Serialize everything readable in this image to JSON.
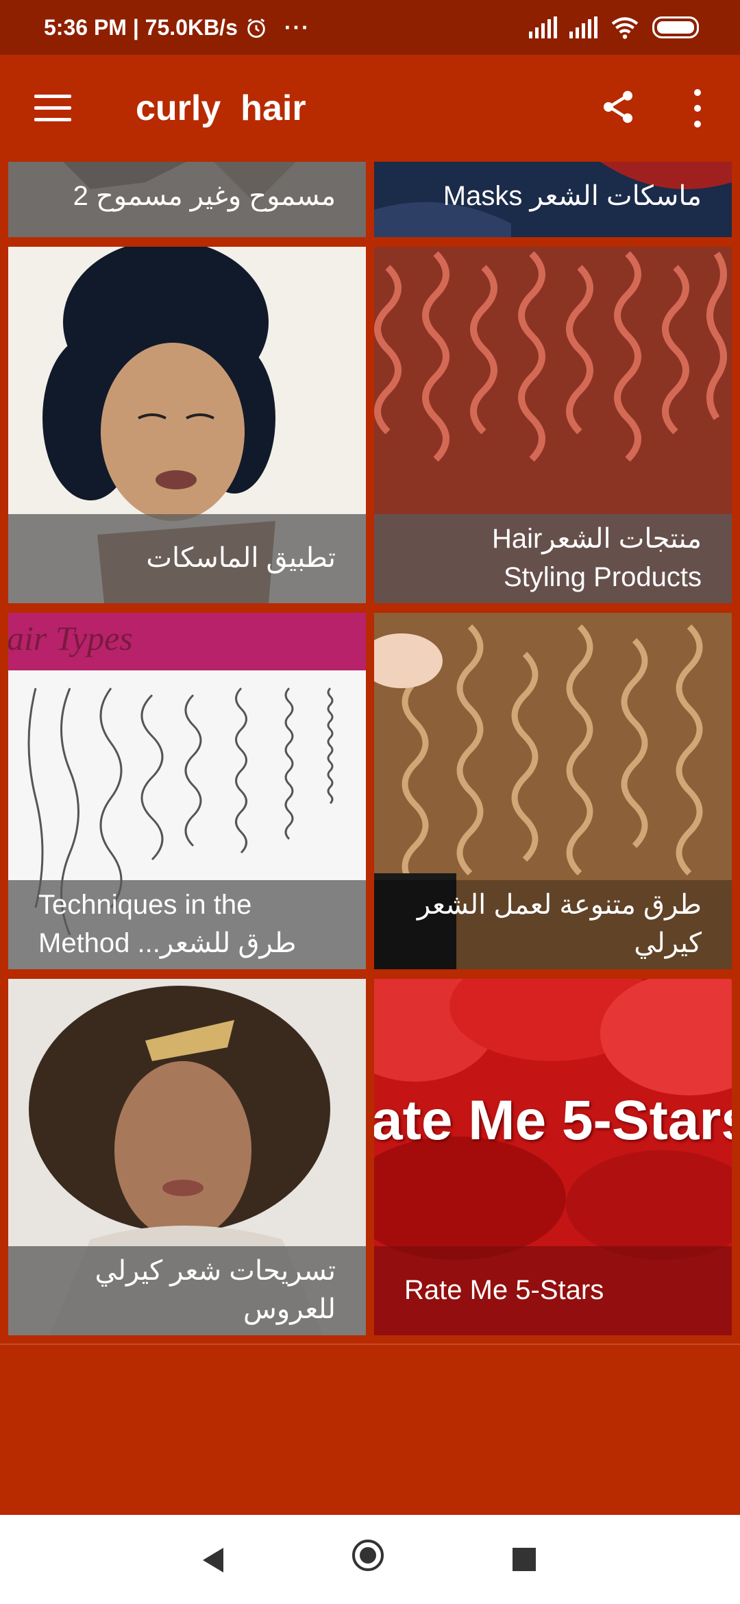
{
  "status_bar": {
    "time_speed": "5:36 PM | 75.0KB/s",
    "alarm_icon": "alarm-clock-icon",
    "more_indicator": "···"
  },
  "app_bar": {
    "title": "curly  hair"
  },
  "cards": [
    {
      "caption": "مسموح وغير مسموح 2",
      "dir": "rtl",
      "colors": [
        "#c8b8a8",
        "#7a6658"
      ]
    },
    {
      "caption": "ماسكات الشعر Masks",
      "dir": "rtl",
      "colors": [
        "#1b2b4a",
        "#a02020"
      ]
    },
    {
      "caption": "تطبيق الماسكات",
      "dir": "rtl",
      "colors": [
        "#f3f0ea",
        "#111a2a"
      ]
    },
    {
      "caption": "منتجات الشعرHair Styling Products",
      "dir": "rtl",
      "colors": [
        "#b44a3a",
        "#6a2418"
      ]
    },
    {
      "caption": "Techniques in the Method ...طرق للشعر الكي",
      "dir": "ltr",
      "colors": [
        "#f4f4f4",
        "#b8226a"
      ]
    },
    {
      "caption": "طرق متنوعة لعمل الشعر كيرلي",
      "dir": "rtl",
      "colors": [
        "#c9a070",
        "#5a3a20"
      ]
    },
    {
      "caption": "تسريحات شعر كيرلي للعروس",
      "dir": "rtl",
      "colors": [
        "#e8e4df",
        "#3a2a1e"
      ]
    },
    {
      "caption": "Rate Me 5-Stars",
      "dir": "ltr",
      "colors": [
        "#b01010",
        "#e02020"
      ]
    }
  ],
  "rate_banner_text": "ate Me 5-Stars",
  "hair_types_text": "air Types",
  "nav_bar": {
    "back": "back-icon",
    "home": "home-icon",
    "recent": "recent-apps-icon"
  }
}
